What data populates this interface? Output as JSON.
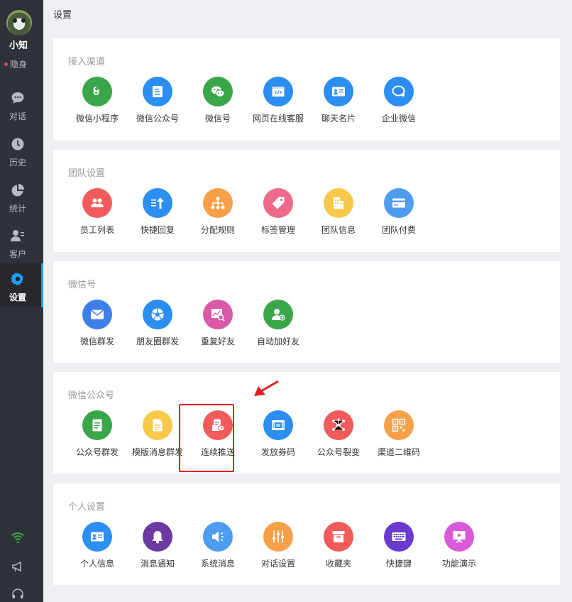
{
  "sidebar": {
    "user_name": "小知",
    "user_status": "隐身",
    "nav": [
      {
        "label": "对话",
        "icon": "chat-bubble-icon"
      },
      {
        "label": "历史",
        "icon": "clock-icon"
      },
      {
        "label": "统计",
        "icon": "pie-chart-icon"
      },
      {
        "label": "客户",
        "icon": "customer-icon"
      },
      {
        "label": "设置",
        "icon": "gear-icon",
        "active": true
      }
    ],
    "bottom_icons": [
      "wifi-icon",
      "megaphone-icon",
      "headset-icon"
    ]
  },
  "header": {
    "title": "设置"
  },
  "colors": {
    "sidebar_bg": "#2f3238",
    "active_indicator": "#1e9fff",
    "highlight_box": "#e02020"
  },
  "sections": [
    {
      "title": "接入渠道",
      "items": [
        {
          "label": "微信小程序",
          "icon": "mini-program-icon",
          "color": "#3aa64a"
        },
        {
          "label": "微信公众号",
          "icon": "official-account-icon",
          "color": "#2b8ef0"
        },
        {
          "label": "微信号",
          "icon": "wechat-icon",
          "color": "#3aa64a"
        },
        {
          "label": "网页在线客服",
          "icon": "web-code-icon",
          "color": "#2b8ef0"
        },
        {
          "label": "聊天名片",
          "icon": "business-card-icon",
          "color": "#2b8ef0"
        },
        {
          "label": "企业微信",
          "icon": "work-wechat-icon",
          "color": "#2b8ef0"
        }
      ]
    },
    {
      "title": "团队设置",
      "items": [
        {
          "label": "员工列表",
          "icon": "staff-icon",
          "color": "#f15b5b"
        },
        {
          "label": "快捷回复",
          "icon": "quick-reply-icon",
          "color": "#2b8ef0"
        },
        {
          "label": "分配规则",
          "icon": "org-tree-icon",
          "color": "#f7a04a"
        },
        {
          "label": "标签管理",
          "icon": "tag-icon",
          "color": "#ef6a8a"
        },
        {
          "label": "团队信息",
          "icon": "building-icon",
          "color": "#f7c94a"
        },
        {
          "label": "团队付费",
          "icon": "credit-card-icon",
          "color": "#4d9cf0"
        }
      ]
    },
    {
      "title": "微信号",
      "items": [
        {
          "label": "微信群发",
          "icon": "mail-icon",
          "color": "#3d7ee8"
        },
        {
          "label": "朋友圈群发",
          "icon": "aperture-icon",
          "color": "#2b8ef0"
        },
        {
          "label": "重复好友",
          "icon": "search-chart-icon",
          "color": "#d85aa8"
        },
        {
          "label": "自动加好友",
          "icon": "add-friend-icon",
          "color": "#3aa64a"
        }
      ]
    },
    {
      "title": "微信公众号",
      "items": [
        {
          "label": "公众号群发",
          "icon": "document-icon",
          "color": "#3aa64a"
        },
        {
          "label": "模版消息群发",
          "icon": "template-icon",
          "color": "#f7c94a"
        },
        {
          "label": "连续推送",
          "icon": "scheduled-push-icon",
          "color": "#f15b5b",
          "highlighted": true
        },
        {
          "label": "发放券码",
          "icon": "coupon-icon",
          "color": "#2b8ef0"
        },
        {
          "label": "公众号裂变",
          "icon": "network-icon",
          "color": "#f15b5b"
        },
        {
          "label": "渠道二维码",
          "icon": "qrcode-icon",
          "color": "#f7a04a"
        }
      ]
    },
    {
      "title": "个人设置",
      "items": [
        {
          "label": "个人信息",
          "icon": "id-card-icon",
          "color": "#2b8ef0"
        },
        {
          "label": "消息通知",
          "icon": "bell-icon",
          "color": "#6a3aa0"
        },
        {
          "label": "系统消息",
          "icon": "speaker-icon",
          "color": "#4d9cf0"
        },
        {
          "label": "对话设置",
          "icon": "sliders-icon",
          "color": "#f7a04a"
        },
        {
          "label": "收藏夹",
          "icon": "inbox-icon",
          "color": "#f15b5b"
        },
        {
          "label": "快捷键",
          "icon": "keyboard-icon",
          "color": "#6a3ad0"
        },
        {
          "label": "功能演示",
          "icon": "presentation-icon",
          "color": "#d85ad8"
        }
      ]
    }
  ]
}
